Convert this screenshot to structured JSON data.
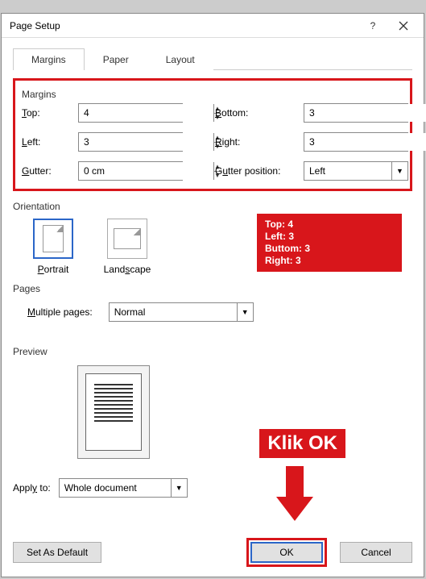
{
  "dialog": {
    "title": "Page Setup"
  },
  "tabs": {
    "margins": "Margins",
    "paper": "Paper",
    "layout": "Layout"
  },
  "margins": {
    "group": "Margins",
    "top_label": "Top:",
    "top_value": "4",
    "bottom_label": "Bottom:",
    "bottom_value": "3",
    "left_label": "Left:",
    "left_value": "3",
    "right_label": "Right:",
    "right_value": "3",
    "gutter_label": "Gutter:",
    "gutter_value": "0 cm",
    "gutter_pos_label": "Gutter position:",
    "gutter_pos_value": "Left"
  },
  "orientation": {
    "group": "Orientation",
    "portrait": "Portrait",
    "landscape": "Landscape"
  },
  "pages": {
    "group": "Pages",
    "multiple_label": "Multiple pages:",
    "multiple_value": "Normal"
  },
  "preview": {
    "group": "Preview"
  },
  "apply": {
    "label": "Apply to:",
    "value": "Whole document"
  },
  "buttons": {
    "default": "Set As Default",
    "ok": "OK",
    "cancel": "Cancel"
  },
  "annotations": {
    "summary_line1": "Top: 4",
    "summary_line2": "Left: 3",
    "summary_line3": "Buttom: 3",
    "summary_line4": "Right: 3",
    "klik": "Klik OK"
  },
  "colors": {
    "highlight": "#d8161b",
    "accent": "#2b66c8"
  }
}
